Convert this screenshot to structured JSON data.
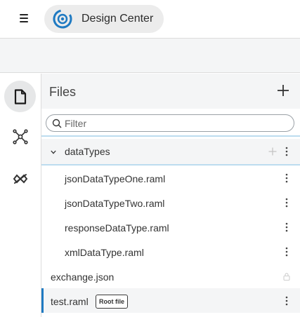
{
  "header": {
    "app_title": "Design Center",
    "menu_icon": "hamburger-menu-icon",
    "logo_icon": "design-center-logo-icon"
  },
  "sidebar": {
    "items": [
      {
        "icon": "file-icon",
        "active": true
      },
      {
        "icon": "api-graph-icon",
        "active": false
      },
      {
        "icon": "exchange-icon",
        "active": false
      }
    ]
  },
  "files_panel": {
    "title": "Files",
    "add_icon": "plus-icon",
    "filter_placeholder": "Filter",
    "folder": {
      "label": "dataTypes",
      "expanded": true,
      "children": [
        {
          "label": "jsonDataTypeOne.raml"
        },
        {
          "label": "jsonDataTypeTwo.raml"
        },
        {
          "label": "responseDataType.raml"
        },
        {
          "label": "xmlDataType.raml"
        }
      ]
    },
    "files": [
      {
        "label": "exchange.json",
        "locked": true
      },
      {
        "label": "test.raml",
        "selected": true,
        "badge": "Root file"
      }
    ]
  },
  "colors": {
    "accent": "#1f7ac2",
    "panel_bg": "#f4f5f6",
    "highlight_border": "#bcdcef"
  }
}
